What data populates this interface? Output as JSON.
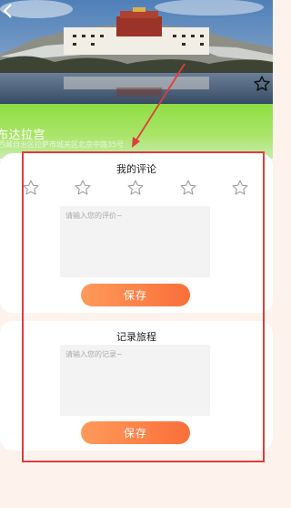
{
  "place": {
    "name": "布达拉宫",
    "address": "西藏自治区拉萨市城关区北京中路35号"
  },
  "icons": {
    "back": "back-chevron-icon",
    "favorite": "star-outline-icon",
    "rating_star": "star-outline-icon"
  },
  "review": {
    "title": "我的评论",
    "rating": 0,
    "rating_max": 5,
    "placeholder": "请输入您的评价~",
    "value": "",
    "save_label": "保存"
  },
  "journey": {
    "title": "记录旅程",
    "placeholder": "请输入您的记录~",
    "value": "",
    "save_label": "保存"
  },
  "colors": {
    "accent_orange_start": "#ff9a5a",
    "accent_orange_end": "#f96f3a",
    "band_green": "#8fde45",
    "annotation_red": "#e33b3b"
  }
}
